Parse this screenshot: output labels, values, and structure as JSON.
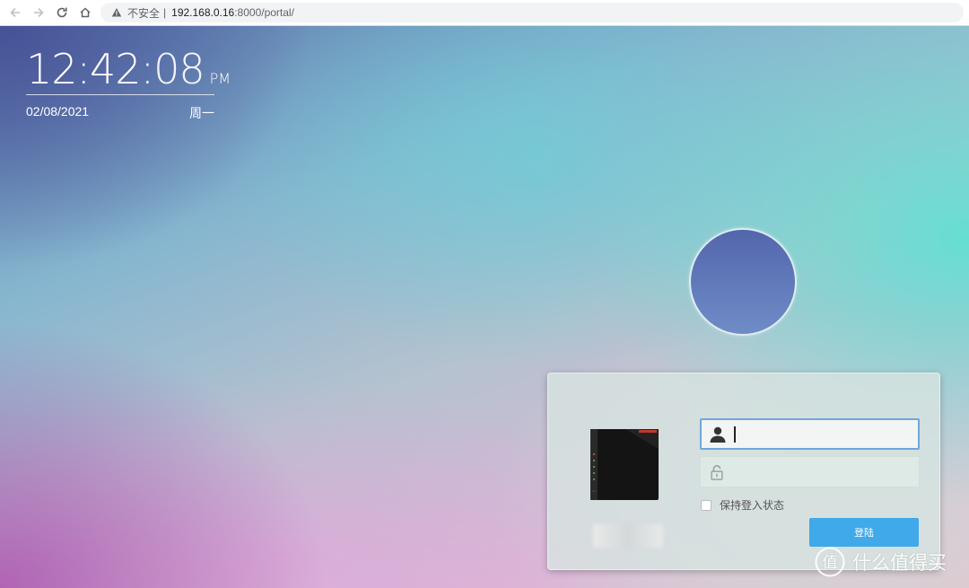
{
  "browser": {
    "security_label": "不安全",
    "separator": "|",
    "url_host": "192.168.0.16",
    "url_path": ":8000/portal/",
    "icons": [
      "back-icon",
      "forward-icon",
      "reload-icon",
      "home-icon",
      "warning-icon"
    ]
  },
  "clock": {
    "hours_minutes": "12:42:",
    "seconds": "08",
    "ampm": "PM",
    "date": "02/08/2021",
    "weekday": "周一"
  },
  "login": {
    "username_value": "",
    "password_value": "",
    "remember_label": "保持登入状态",
    "remember_checked": false,
    "login_button_label": "登陆",
    "accent_color": "#3fa9ea"
  },
  "watermark": {
    "text": "什么值得买"
  }
}
